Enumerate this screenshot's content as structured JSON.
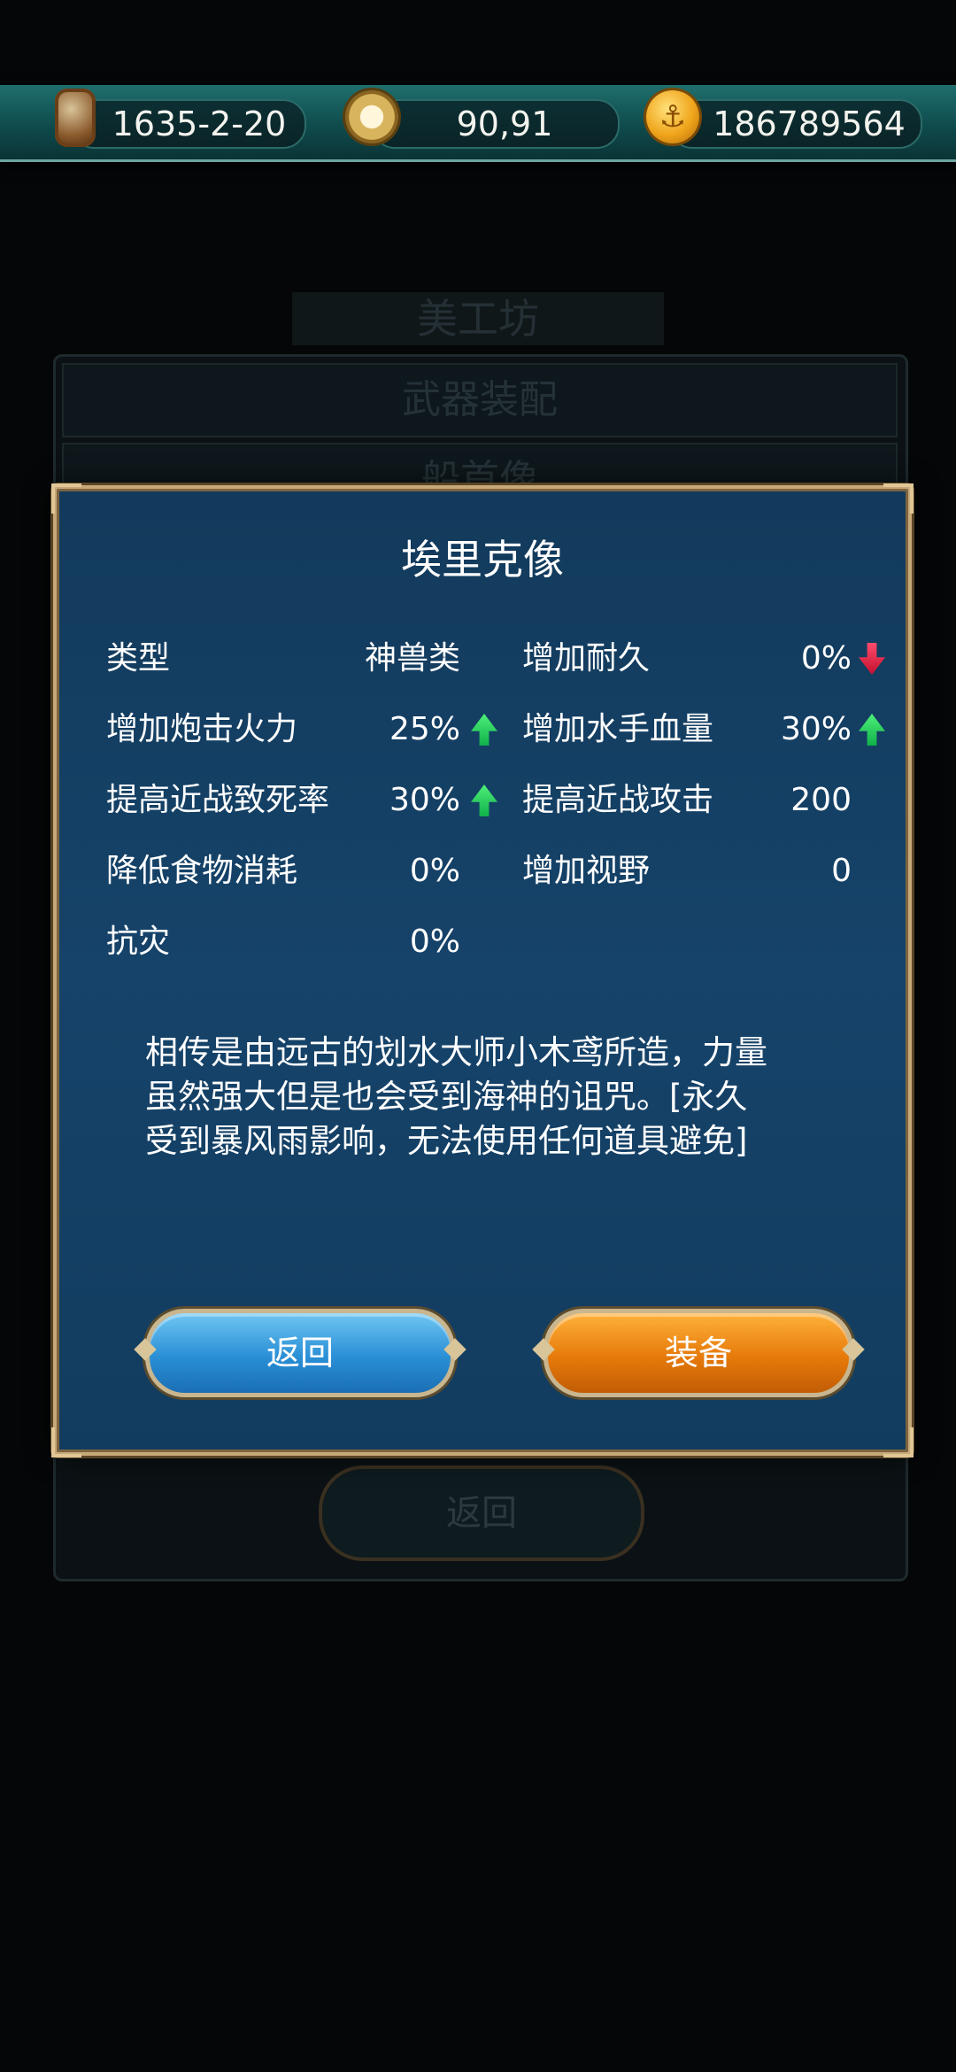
{
  "topbar": {
    "date": "1635-2-20",
    "coords": "90,91",
    "gold": "186789564",
    "icons": [
      "hourglass-icon",
      "compass-icon",
      "anchor-coin-icon"
    ]
  },
  "background": {
    "title": "美工坊",
    "rows": [
      "武器装配",
      "船首像"
    ],
    "back": "返回"
  },
  "dialog": {
    "title": "埃里克像",
    "stats_left": [
      {
        "label": "类型",
        "value": "神兽类",
        "trend": null
      },
      {
        "label": "增加炮击火力",
        "value": "25%",
        "trend": "up"
      },
      {
        "label": "提高近战致死率",
        "value": "30%",
        "trend": "up"
      },
      {
        "label": "降低食物消耗",
        "value": "0%",
        "trend": null
      },
      {
        "label": "抗灾",
        "value": "0%",
        "trend": null
      }
    ],
    "stats_right": [
      {
        "label": "增加耐久",
        "value": "0%",
        "trend": "down"
      },
      {
        "label": "增加水手血量",
        "value": "30%",
        "trend": "up"
      },
      {
        "label": "提高近战攻击",
        "value": "200",
        "trend": null
      },
      {
        "label": "增加视野",
        "value": "0",
        "trend": null
      }
    ],
    "description": [
      "相传是由远古的划水大师小木鸢所造，力量",
      "虽然强大但是也会受到海神的诅咒。[永久",
      "受到暴风雨影响，无法使用任何道具避免]"
    ],
    "buttons": {
      "back": "返回",
      "equip": "装备"
    }
  },
  "colors": {
    "up_arrow": "#1fcf5a",
    "down_arrow": "#e2163f",
    "back_button": "#2a8fd6",
    "equip_button": "#e67a0a"
  }
}
